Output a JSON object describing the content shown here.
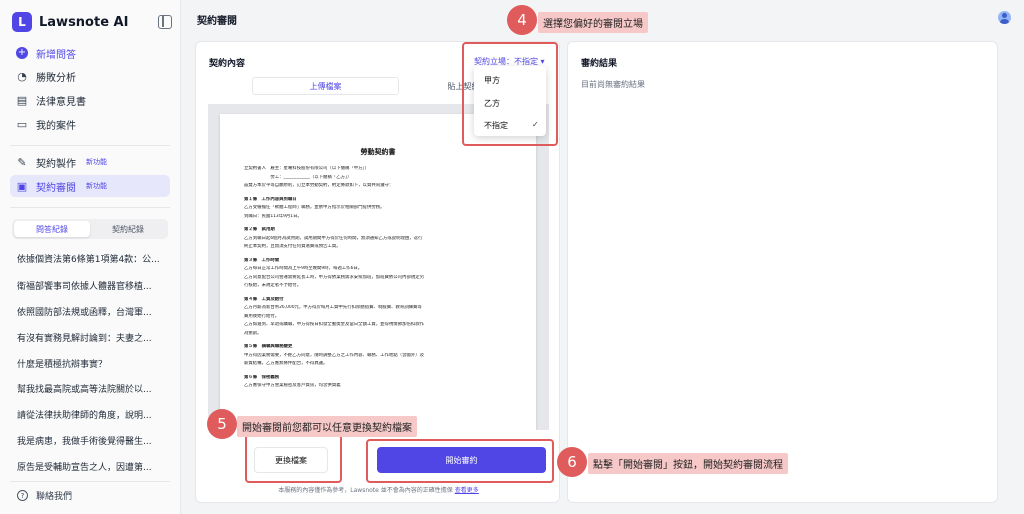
{
  "brand": {
    "name": "Lawsnote AI"
  },
  "nav": [
    {
      "label": "新增問答",
      "icon": "plus-circle-icon",
      "badge": ""
    },
    {
      "label": "勝敗分析",
      "icon": "pie-chart-icon",
      "badge": ""
    },
    {
      "label": "法律意見書",
      "icon": "document-icon",
      "badge": ""
    },
    {
      "label": "我的案件",
      "icon": "folder-icon",
      "badge": ""
    },
    {
      "label": "契約製作",
      "icon": "pen-icon",
      "badge": "新功能"
    },
    {
      "label": "契約審閱",
      "icon": "contract-review-icon",
      "badge": "新功能"
    }
  ],
  "history_tabs": [
    "問答紀錄",
    "契約紀錄"
  ],
  "history": [
    "依據個資法第6條第1項第4款：公...",
    "衛福部饗事司依據人體器官移植...",
    "依照國防部法規或函釋，台灣軍...",
    "有沒有實務見解討論到：夫妻之...",
    "什麼是積極抗辯事實？",
    "幫我找最高院或高等法院關於以...",
    "請從法律扶助律師的角度，說明...",
    "我是病患，我做手術後覺得醫生...",
    "原告是受輔助宣告之人，因遭第..."
  ],
  "contact": "聯絡我們",
  "page_title": "契約審閱",
  "left": {
    "title": "契約內容",
    "stance": "契約立場：不指定 ▾",
    "tabs": [
      "上傳檔案",
      "貼上契約文字"
    ],
    "replace": "更換檔案",
    "start": "開始審約",
    "disclaimer": "本服務的內容僅作為參考，Lawsnote 並不會為內容的正確性擔保",
    "more": "查看更多"
  },
  "dropdown": {
    "options": [
      "甲方",
      "乙方",
      "不指定"
    ],
    "check": "✓"
  },
  "right": {
    "title": "審約結果",
    "empty": "目前尚無審約結果"
  },
  "doc": {
    "title": "勞動契約書",
    "lines": [
      "立契約書人　雇主：星曜科技股份有限公司（以下簡稱「甲方」）",
      "　　　　　　勞工：____________（以下簡稱「乙方」）",
      "茲雙方本於平等自願原則，訂立本勞動契約，約定條款如下，以資共同遵守：",
      "第１條　工作內容與到職日",
      "乙方受僱擔任「軟體工程師」職務，並依甲方指示於相關部門提供勞務。",
      "到職日：民國113年9月1日。",
      "第２條　試用期",
      "乙方到職日起6個月為試用期，試用期間甲方得於任何時間，無須通知乙方或說明理由，逕行",
      "終止本契約，且無須支付任何資遣費或預告工資。",
      "第３條　工作時間",
      "乙方每日正常工作時間為上午9時至晚間9時，每週工作6日。",
      "乙方同意配合公司營運需要延長工時，甲方得依業務需求安排加班，加班費依公司內部規定另",
      "行核給，未規定者不予給付。",
      "第４條　工資及給付",
      "乙方月薪為新台幣26,000元，甲方得於每月工資中先行扣除膳宿費、制服費、教育訓練費等",
      "費用後始行給付。",
      "乙方如遲到、早退或曠職，甲方得按日扣發全勤獎金及當日全額工資，並得視情節加倍扣款作",
      "為懲罰。",
      "第５條　調職與職務變更",
      "甲方得因業務需要，不經乙方同意，隨時調整乙方之工作內容、職務、工作地點（含國外）及",
      "薪資結構，乙方應無條件配合，不得異議。",
      "第６條　保密義務",
      "乙方應保守甲方營業秘密及客戶資訊，均含供資義"
    ]
  },
  "annotations": {
    "step4": {
      "number": "4",
      "text": "選擇您偏好的審閱立場"
    },
    "step5": {
      "number": "5",
      "text": "開始審閱前您都可以任意更換契約檔案"
    },
    "step6": {
      "number": "6",
      "text": "點擊「開始審閱」按鈕，開始契約審閱流程"
    }
  }
}
